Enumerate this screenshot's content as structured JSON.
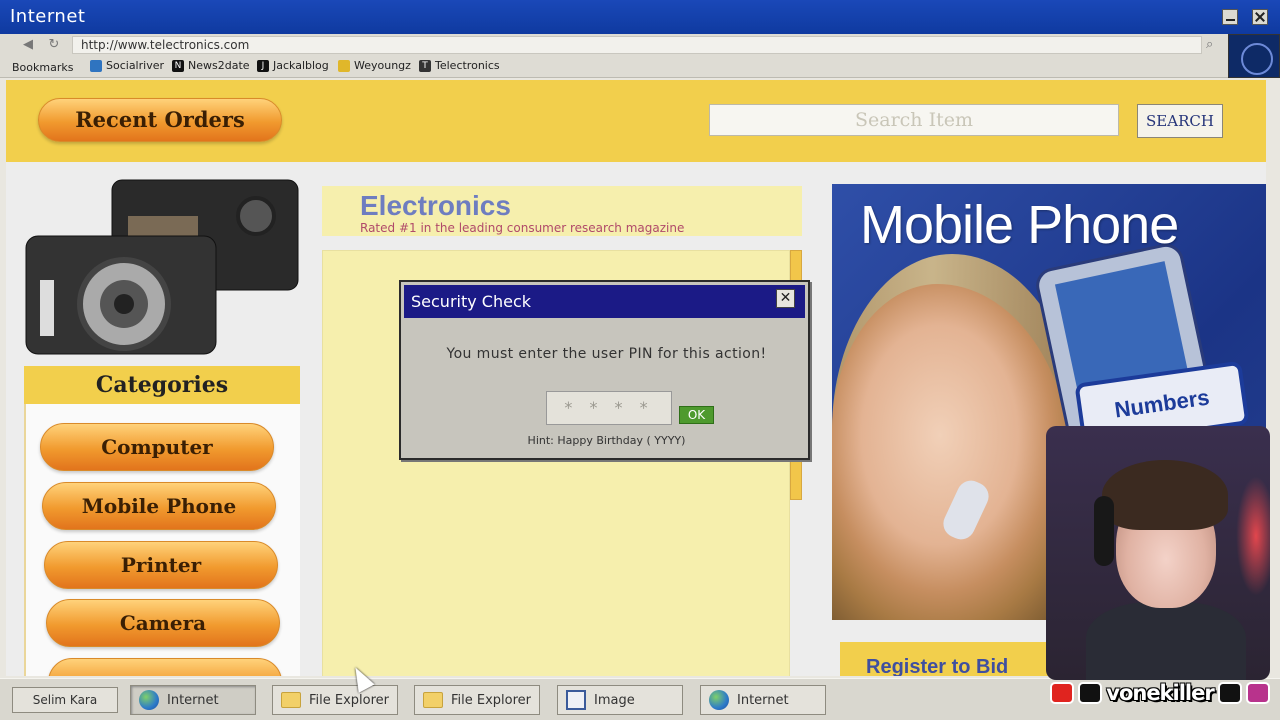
{
  "window": {
    "title": "Internet"
  },
  "browser": {
    "url": "http://www.telectronics.com",
    "bookmarks_label": "Bookmarks",
    "bookmarks": [
      {
        "label": "Socialriver",
        "color": "#2f74c0"
      },
      {
        "label": "News2date",
        "color": "#111111"
      },
      {
        "label": "Jackalblog",
        "color": "#111111"
      },
      {
        "label": "Weyoungz",
        "color": "#e0b72a"
      },
      {
        "label": "Telectronics",
        "color": "#333333"
      }
    ]
  },
  "page": {
    "recent_orders": "Recent Orders",
    "search_placeholder": "Search Item",
    "search_button": "SEARCH",
    "categories_title": "Categories",
    "categories": [
      "Computer",
      "Mobile Phone",
      "Printer",
      "Camera"
    ],
    "brand": "Electronics",
    "tagline": "Rated #1 in the leading consumer research magazine",
    "ad_title": "Mobile Phone",
    "ad_badge": "Numbers",
    "register": "Register to Bid"
  },
  "dialog": {
    "title": "Security Check",
    "message": "You must enter the user PIN for this action!",
    "pin_placeholder": "* * * *",
    "ok": "OK",
    "hint": "Hint: Happy Birthday ( YYYY)"
  },
  "taskbar": {
    "user": "Selim Kara",
    "tasks": [
      {
        "label": "Internet",
        "icon": "globe-icon",
        "active": true
      },
      {
        "label": "File Explorer",
        "icon": "folder-icon",
        "active": false
      },
      {
        "label": "File Explorer",
        "icon": "folder-icon",
        "active": false
      },
      {
        "label": "Image",
        "icon": "image-icon",
        "active": false
      },
      {
        "label": "Internet",
        "icon": "globe-icon",
        "active": false
      }
    ]
  },
  "overlay": {
    "handle": "vonekiller"
  },
  "colors": {
    "titlebar": "#1a48b8",
    "dialog_title": "#1b1a86",
    "page_band": "#f2cf4c",
    "ok": "#4e9a2e"
  }
}
